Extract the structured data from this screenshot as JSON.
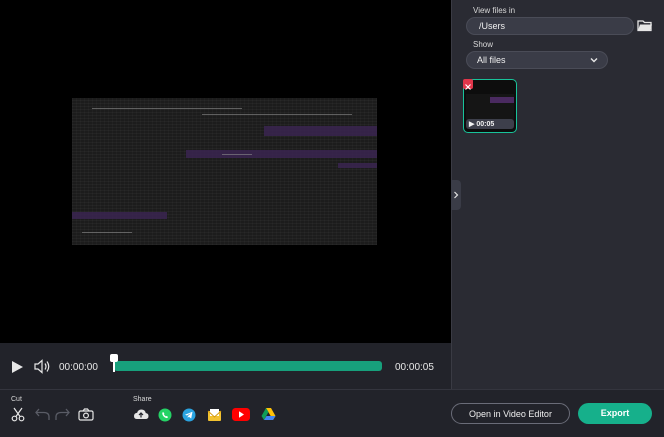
{
  "player": {
    "current_time": "00:00:00",
    "duration": "00:00:05",
    "progress_fraction": 0.0
  },
  "files_panel": {
    "view_files_label": "View files in",
    "path": "/Users",
    "show_label": "Show",
    "show_selected": "All files",
    "items": [
      {
        "duration": "00:05"
      }
    ]
  },
  "toolbar": {
    "cut_label": "Cut",
    "share_label": "Share",
    "share_targets": [
      "cloud-icon",
      "whatsapp-icon",
      "telegram-icon",
      "email-icon",
      "youtube-icon",
      "google-drive-icon"
    ]
  },
  "actions": {
    "open_editor_label": "Open in Video Editor",
    "export_label": "Export"
  },
  "colors": {
    "accent": "#16b08b",
    "progress": "#17a07c",
    "thumb_border": "#18c39a",
    "delete": "#e0354a"
  }
}
